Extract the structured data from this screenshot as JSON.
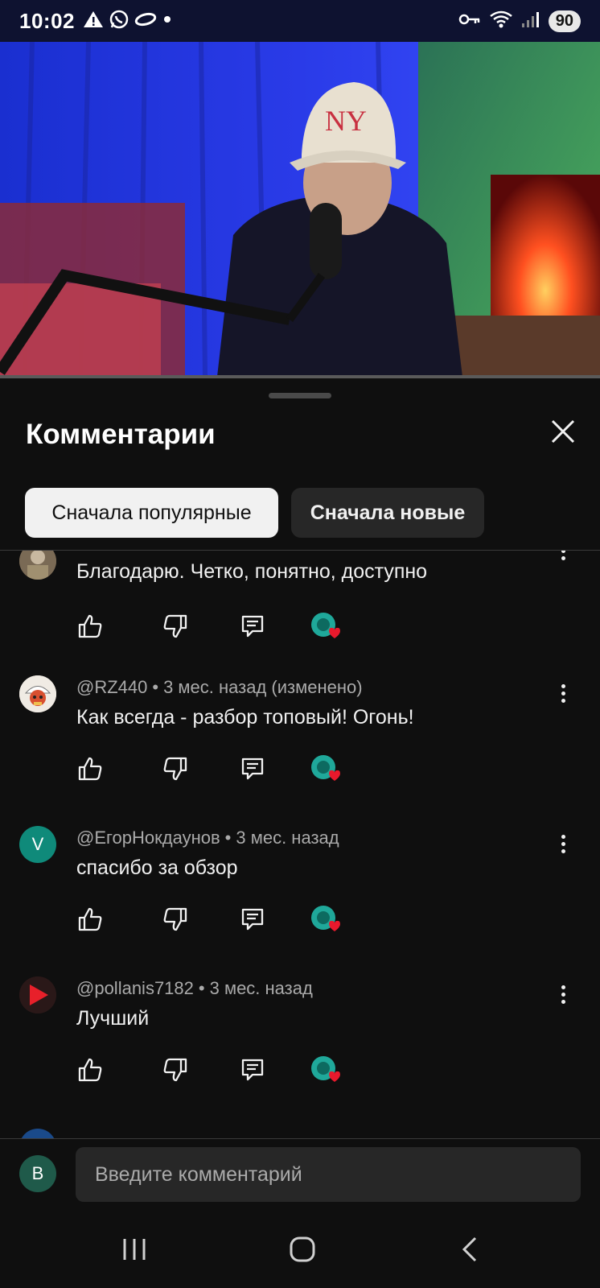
{
  "status_bar": {
    "time": "10:02",
    "left_icons": [
      "warning-icon",
      "whatsapp-icon",
      "link-icon",
      "dot-icon"
    ],
    "right_icons": [
      "key-icon",
      "wifi-icon",
      "signal-icon"
    ],
    "battery": "90"
  },
  "video": {
    "description_icon": "video-frame",
    "progress": 0.0
  },
  "comments_sheet": {
    "title": "Комментарии",
    "close_icon": "close-icon",
    "sort_chips": [
      {
        "label": "Сначала популярные",
        "active": true
      },
      {
        "label": "Сначала новые",
        "active": false
      }
    ],
    "comments": [
      {
        "author": "",
        "time": "",
        "text": "Благодарю. Четко, понятно, доступно",
        "avatar_letter": "",
        "avatar_color": "#5a4a3a"
      },
      {
        "author": "@RZ440",
        "time": "3 мес. назад (изменено)",
        "text": "Как всегда - разбор топовый! Огонь!",
        "avatar_letter": "",
        "avatar_color": "#e8e0d8"
      },
      {
        "author": "@ЕгорНокдаунов",
        "time": "3 мес. назад",
        "text": "спасибо за обзор",
        "avatar_letter": "V",
        "avatar_color": "#0f8a7a"
      },
      {
        "author": "@pollanis7182",
        "time": "3 мес. назад",
        "text": "Лучший",
        "avatar_letter": "",
        "avatar_color": "#2a1a1a"
      }
    ]
  },
  "composer": {
    "avatar_letter": "B",
    "placeholder": "Введите комментарий"
  },
  "nav_bar": {
    "buttons": [
      "recent-apps-icon",
      "home-icon",
      "back-icon"
    ]
  },
  "colors": {
    "background": "#0f0f0f",
    "chip_active": "#f1f1f1",
    "chip_inactive": "#272727",
    "heart": "#e8192c",
    "creator_badge": "#1fa89a"
  }
}
